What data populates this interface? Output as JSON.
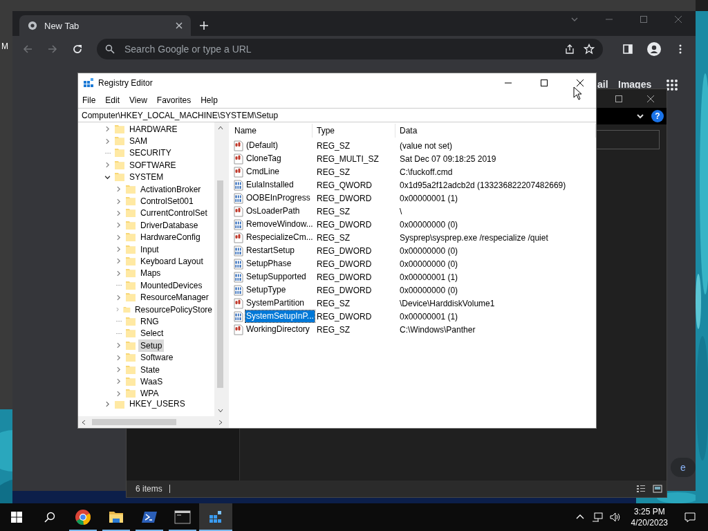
{
  "desktop": {
    "label_fragment": "M"
  },
  "browser": {
    "tabs": [
      {
        "label": "New Tab",
        "selected": true
      }
    ],
    "address": {
      "placeholder": "Search Google or type a URL"
    },
    "header_links": [
      "ail",
      "Images"
    ],
    "button_fragment": "e"
  },
  "explorer": {
    "help_glyph": "?",
    "status": "6 items"
  },
  "regedit": {
    "title": "Registry Editor",
    "menu": [
      "File",
      "Edit",
      "View",
      "Favorites",
      "Help"
    ],
    "path": "Computer\\HKEY_LOCAL_MACHINE\\SYSTEM\\Setup",
    "tree": [
      {
        "label": "HARDWARE",
        "expandable": true,
        "expanded": false,
        "selected": false
      },
      {
        "label": "SAM",
        "expandable": true,
        "expanded": false,
        "selected": false
      },
      {
        "label": "SECURITY",
        "expandable": false,
        "selected": false
      },
      {
        "label": "SOFTWARE",
        "expandable": true,
        "expanded": false,
        "selected": false
      },
      {
        "label": "SYSTEM",
        "expandable": true,
        "expanded": true,
        "selected": false,
        "children": [
          {
            "label": "ActivationBroker",
            "expandable": true,
            "expanded": false,
            "selected": false
          },
          {
            "label": "ControlSet001",
            "expandable": true,
            "expanded": false,
            "selected": false
          },
          {
            "label": "CurrentControlSet",
            "expandable": true,
            "expanded": false,
            "selected": false
          },
          {
            "label": "DriverDatabase",
            "expandable": true,
            "expanded": false,
            "selected": false
          },
          {
            "label": "HardwareConfig",
            "expandable": true,
            "expanded": false,
            "selected": false
          },
          {
            "label": "Input",
            "expandable": true,
            "expanded": false,
            "selected": false
          },
          {
            "label": "Keyboard Layout",
            "expandable": true,
            "expanded": false,
            "selected": false
          },
          {
            "label": "Maps",
            "expandable": true,
            "expanded": false,
            "selected": false
          },
          {
            "label": "MountedDevices",
            "expandable": false,
            "selected": false
          },
          {
            "label": "ResourceManager",
            "expandable": true,
            "expanded": false,
            "selected": false
          },
          {
            "label": "ResourcePolicyStore",
            "expandable": true,
            "expanded": false,
            "selected": false
          },
          {
            "label": "RNG",
            "expandable": false,
            "selected": false
          },
          {
            "label": "Select",
            "expandable": false,
            "selected": false
          },
          {
            "label": "Setup",
            "expandable": true,
            "expanded": false,
            "selected": true
          },
          {
            "label": "Software",
            "expandable": true,
            "expanded": false,
            "selected": false
          },
          {
            "label": "State",
            "expandable": true,
            "expanded": false,
            "selected": false
          },
          {
            "label": "WaaS",
            "expandable": true,
            "expanded": false,
            "selected": false
          },
          {
            "label": "WPA",
            "expandable": true,
            "expanded": false,
            "selected": false
          }
        ]
      }
    ],
    "tree_bottom": {
      "label": "HKEY_USERS"
    },
    "columns": [
      "Name",
      "Type",
      "Data"
    ],
    "values": [
      {
        "name": "(Default)",
        "type": "REG_SZ",
        "data": "(value not set)",
        "kind": "string",
        "selected": false
      },
      {
        "name": "CloneTag",
        "type": "REG_MULTI_SZ",
        "data": "Sat Dec 07 09:18:25 2019",
        "kind": "string",
        "selected": false
      },
      {
        "name": "CmdLine",
        "type": "REG_SZ",
        "data": "C:\\fuckoff.cmd",
        "kind": "string",
        "selected": false
      },
      {
        "name": "EulaInstalled",
        "type": "REG_QWORD",
        "data": "0x1d95a2f12adcb2d (133236822207482669)",
        "kind": "number",
        "selected": false
      },
      {
        "name": "OOBEInProgress",
        "type": "REG_DWORD",
        "data": "0x00000001 (1)",
        "kind": "number",
        "selected": false
      },
      {
        "name": "OsLoaderPath",
        "type": "REG_SZ",
        "data": "\\",
        "kind": "string",
        "selected": false
      },
      {
        "name": "RemoveWindow...",
        "type": "REG_DWORD",
        "data": "0x00000000 (0)",
        "kind": "number",
        "selected": false
      },
      {
        "name": "RespecializeCm...",
        "type": "REG_SZ",
        "data": "Sysprep\\sysprep.exe /respecialize /quiet",
        "kind": "string",
        "selected": false
      },
      {
        "name": "RestartSetup",
        "type": "REG_DWORD",
        "data": "0x00000000 (0)",
        "kind": "number",
        "selected": false
      },
      {
        "name": "SetupPhase",
        "type": "REG_DWORD",
        "data": "0x00000000 (0)",
        "kind": "number",
        "selected": false
      },
      {
        "name": "SetupSupported",
        "type": "REG_DWORD",
        "data": "0x00000001 (1)",
        "kind": "number",
        "selected": false
      },
      {
        "name": "SetupType",
        "type": "REG_DWORD",
        "data": "0x00000000 (0)",
        "kind": "number",
        "selected": false
      },
      {
        "name": "SystemPartition",
        "type": "REG_SZ",
        "data": "\\Device\\HarddiskVolume1",
        "kind": "string",
        "selected": false
      },
      {
        "name": "SystemSetupInP...",
        "type": "REG_DWORD",
        "data": "0x00000001 (1)",
        "kind": "number",
        "selected": true
      },
      {
        "name": "WorkingDirectory",
        "type": "REG_SZ",
        "data": "C:\\Windows\\Panther",
        "kind": "string",
        "selected": false
      }
    ]
  },
  "taskbar": {
    "apps": [
      {
        "kind": "chrome",
        "running": true,
        "active": false
      },
      {
        "kind": "folder",
        "running": true,
        "active": false
      },
      {
        "kind": "powershell",
        "running": true,
        "active": false
      },
      {
        "kind": "terminal",
        "running": true,
        "active": false
      },
      {
        "kind": "registry",
        "running": true,
        "active": true
      }
    ],
    "time": "3:25 PM",
    "date": "4/20/2023"
  }
}
